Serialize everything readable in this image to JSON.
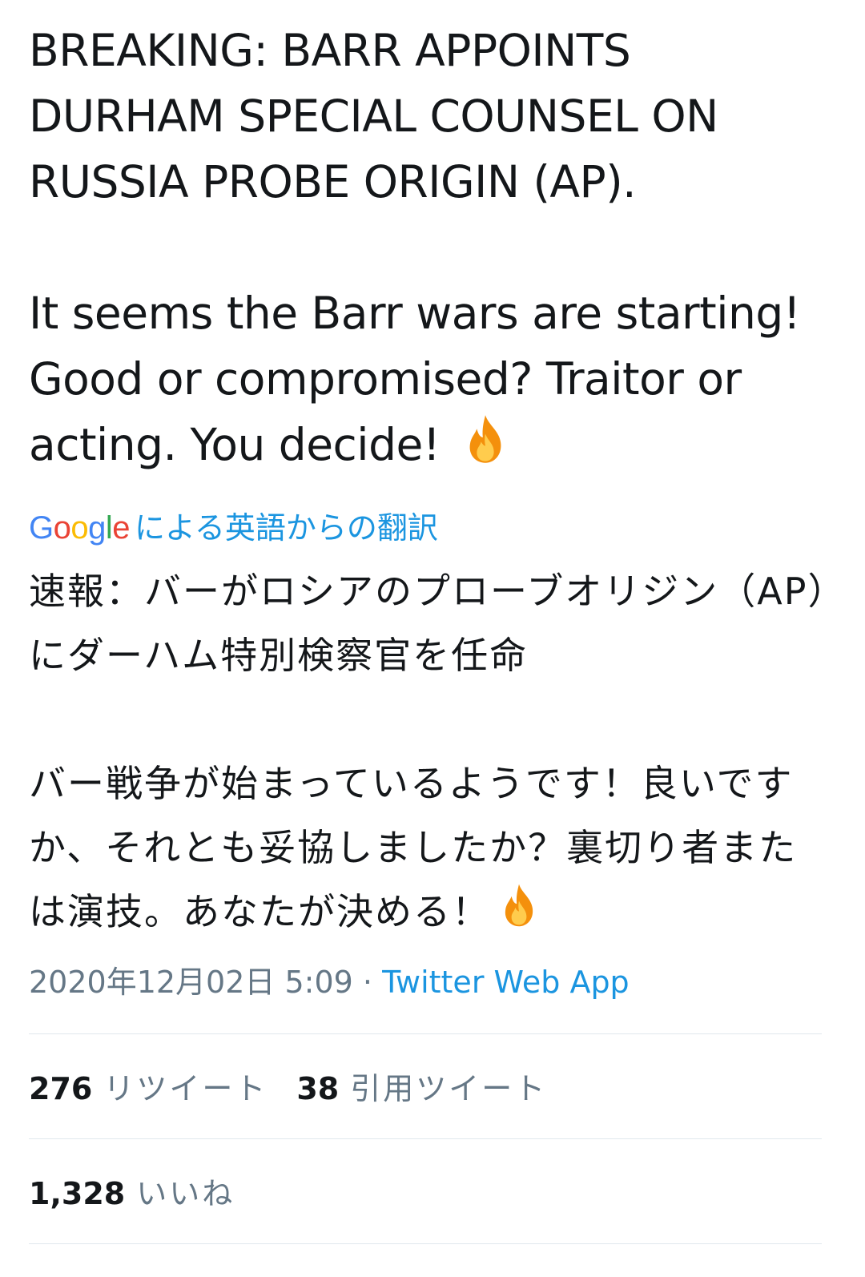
{
  "tweet": {
    "original_paragraphs": [
      "BREAKING: BARR APPOINTS DURHAM SPECIAL COUNSEL ON RUSSIA PROBE ORIGIN (AP).",
      "It seems the Barr wars are starting! Good or compromised? Traitor or acting. You decide!"
    ],
    "translation_attribution": {
      "provider_logo_text": [
        "G",
        "o",
        "o",
        "g",
        "l",
        "e"
      ],
      "label": "による英語からの翻訳"
    },
    "translated_paragraphs": [
      "速報：バーがロシアのプローブオリジン（AP）にダーハム特別検察官を任命",
      "バー戦争が始まっているようです！良いですか、それとも妥協しましたか？裏切り者または演技。あなたが決める！"
    ],
    "emoji_icon": "fire-icon",
    "timestamp": "2020年12月02日 5:09",
    "separator": " · ",
    "source": "Twitter Web App"
  },
  "stats": {
    "retweets": {
      "count": "276",
      "label": "リツイート"
    },
    "quote_tweets": {
      "count": "38",
      "label": "引用ツイート"
    },
    "likes": {
      "count": "1,328",
      "label": "いいね"
    }
  },
  "colors": {
    "text": "#14171a",
    "muted": "#657786",
    "link": "#1b95e0",
    "divider": "#e1e8ed",
    "google_blue": "#4285f4",
    "google_red": "#ea4335",
    "google_yellow": "#fbbc05",
    "google_green": "#34a853"
  }
}
